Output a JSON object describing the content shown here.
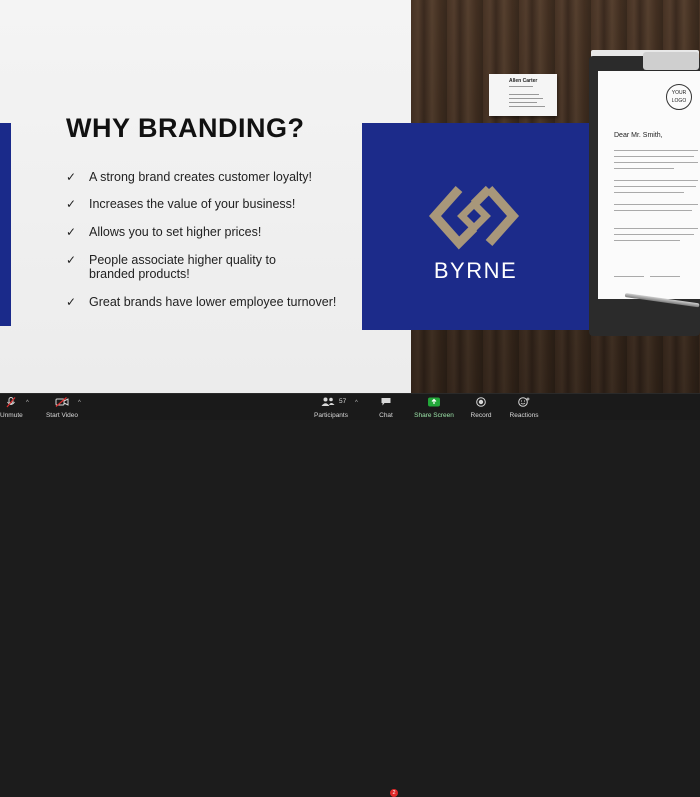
{
  "slide": {
    "title": "WHY  BRANDING?",
    "bullets": [
      "A strong brand creates customer loyalty!",
      "Increases the value of your business!",
      "Allows you to set higher prices!",
      "People associate higher quality to branded products!",
      "Great brands have lower employee turnover!"
    ],
    "check_glyph": "✓",
    "brand_name": "BYRNE",
    "colors": {
      "navy": "#1c2b8a",
      "gold": "#a8977a",
      "background": "#f4f4f4"
    }
  },
  "mockup": {
    "business_card_name": "Allen Carter",
    "letter_greeting": "Dear Mr. Smith,",
    "logo_text": [
      "YOUR",
      "LOGO"
    ]
  },
  "toolbar": {
    "unmute": "Unmute",
    "start_video": "Start Video",
    "participants": "Participants",
    "participants_count": "57",
    "chat": "Chat",
    "chat_badge": "2",
    "share_screen": "Share Screen",
    "record": "Record",
    "reactions": "Reactions",
    "share_color": "#22a83a"
  }
}
